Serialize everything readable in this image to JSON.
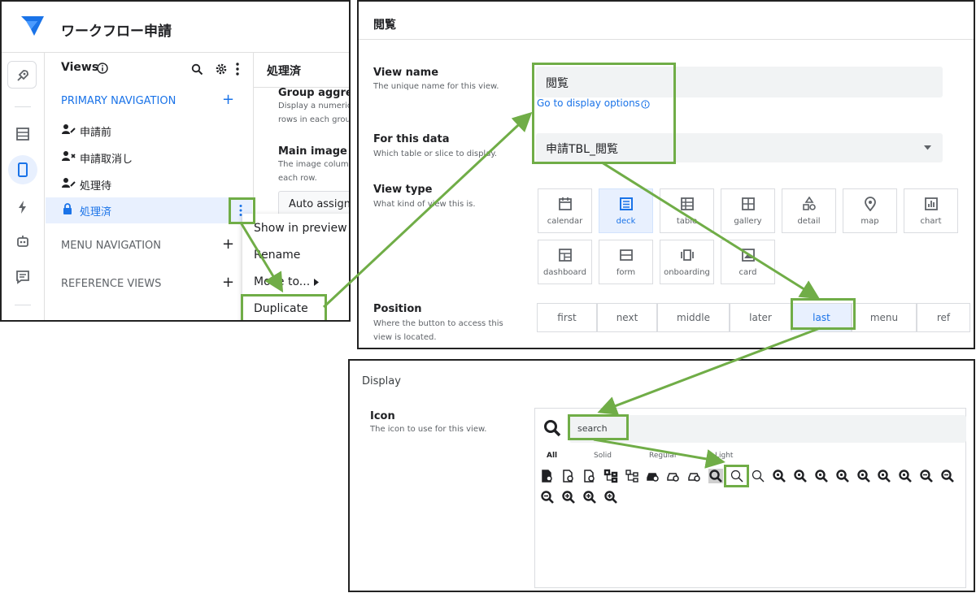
{
  "panel1": {
    "app_title": "ワークフロー申請",
    "views_label": "Views",
    "primary_nav_label": "PRIMARY NAVIGATION",
    "menu_nav_label": "MENU NAVIGATION",
    "reference_views_label": "REFERENCE VIEWS",
    "nav_items": [
      {
        "label": "申請前",
        "icon": "user-edit-icon"
      },
      {
        "label": "申請取消し",
        "icon": "user-x-icon"
      },
      {
        "label": "処理待",
        "icon": "user-edit-icon"
      },
      {
        "label": "処理済",
        "icon": "lock-icon",
        "selected": true
      }
    ],
    "content": {
      "header": "処理済",
      "group_agg_label": "Group aggrega",
      "group_agg_desc1": "Display a numeric",
      "group_agg_desc2": "rows in each grou",
      "main_image_label": "Main image",
      "main_image_desc1": "The image colum",
      "main_image_desc2": "each row.",
      "main_image_value": "Auto assign"
    },
    "context_menu": [
      "Show in preview",
      "Rename",
      "Move to...",
      "Duplicate"
    ]
  },
  "panel2": {
    "title": "閲覧",
    "view_name": {
      "label": "View name",
      "desc": "The unique name for this view.",
      "value": "閲覧"
    },
    "display_link": "Go to display options",
    "for_data": {
      "label": "For this data",
      "desc": "Which table or slice to display.",
      "value": "申請TBL_閲覧"
    },
    "view_type": {
      "label": "View type",
      "desc": "What kind of view this is.",
      "selected": "deck",
      "options": [
        "calendar",
        "deck",
        "table",
        "gallery",
        "detail",
        "map",
        "chart",
        "dashboard",
        "form",
        "onboarding",
        "card"
      ]
    },
    "position": {
      "label": "Position",
      "desc1": "Where the button to access this",
      "desc2": "view is located.",
      "selected": "last",
      "options": [
        "first",
        "next",
        "middle",
        "later",
        "last",
        "menu",
        "ref"
      ]
    }
  },
  "panel3": {
    "title": "Display",
    "icon_label": "Icon",
    "icon_desc": "The icon to use for this view.",
    "search_value": "search",
    "tabs": [
      "All",
      "Solid",
      "Regular",
      "Light"
    ]
  },
  "colors": {
    "accent": "#1a73e8",
    "highlight": "#70ad47",
    "selected_bg": "#e8f0fe"
  }
}
